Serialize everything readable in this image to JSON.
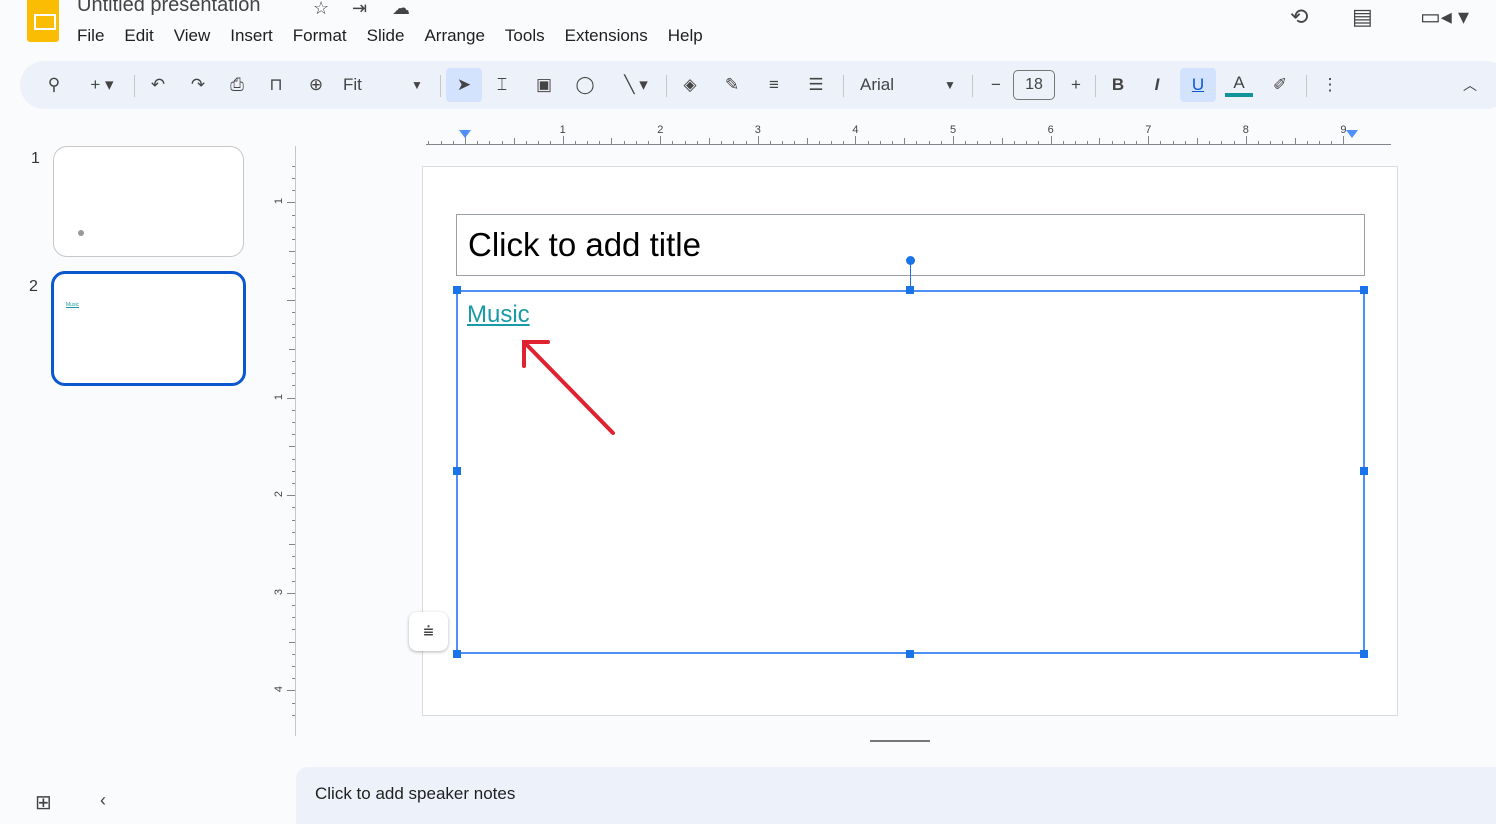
{
  "app": {
    "title": "Untitled presentation",
    "brand_color": "#fbbc04"
  },
  "menu": [
    "File",
    "Edit",
    "View",
    "Insert",
    "Format",
    "Slide",
    "Arrange",
    "Tools",
    "Extensions",
    "Help"
  ],
  "toolbar": {
    "zoom": "Fit",
    "font": "Arial",
    "font_size": "18",
    "text_color": "#12939a"
  },
  "ruler": {
    "horizontal": [
      "1",
      "2",
      "3",
      "4",
      "5",
      "6",
      "7",
      "8",
      "9"
    ],
    "vertical": [
      "1",
      "1",
      "2",
      "3",
      "4"
    ]
  },
  "slides": [
    {
      "number": "1"
    },
    {
      "number": "2",
      "text": "Music",
      "selected": true
    }
  ],
  "slide": {
    "title_placeholder": "Click to add title",
    "body_text": "Music",
    "link_color": "#1a9aa6"
  },
  "notes": {
    "placeholder": "Click to add speaker notes"
  },
  "accent": "#1a73e8",
  "annotation_color": "#e0212f"
}
